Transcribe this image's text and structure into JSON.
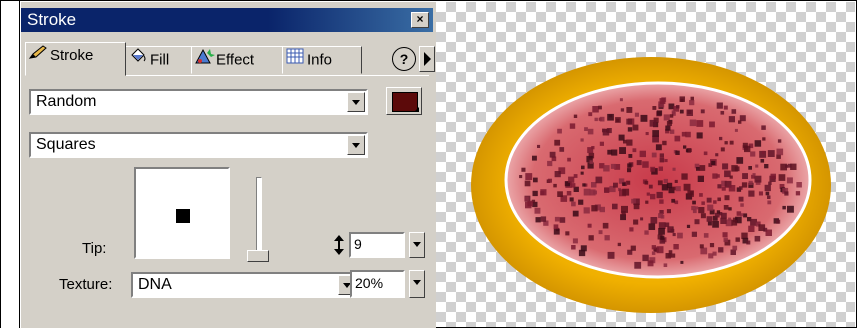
{
  "panel": {
    "title": "Stroke",
    "close_label": "×",
    "tabs": [
      {
        "label": "Stroke",
        "icon": "pencil-icon"
      },
      {
        "label": "Fill",
        "icon": "paint-bucket-icon"
      },
      {
        "label": "Effect",
        "icon": "effect-icon"
      },
      {
        "label": "Info",
        "icon": "info-grid-icon"
      }
    ],
    "help_label": "?"
  },
  "stroke": {
    "category": "Random",
    "type": "Squares",
    "color": "#5c0a0a",
    "tip_label": "Tip:",
    "tip_size": "9",
    "texture_label": "Texture:",
    "texture": "DNA",
    "texture_amount": "20%"
  },
  "colors": {
    "panel_bg": "#d4d0c8",
    "titlebar": "#0a246a",
    "ellipse_outer": "#e8a600",
    "ellipse_inner": "#d9606a"
  }
}
